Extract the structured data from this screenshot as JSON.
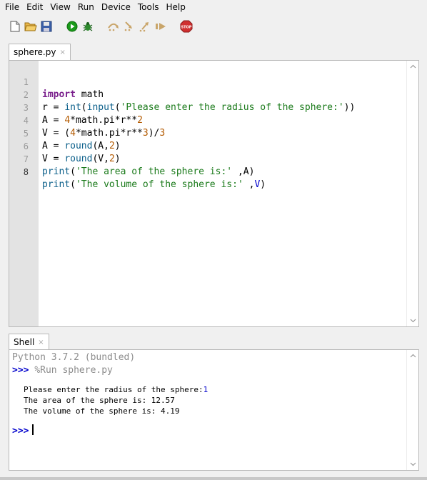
{
  "menu": {
    "items": [
      "File",
      "Edit",
      "View",
      "Run",
      "Device",
      "Tools",
      "Help"
    ]
  },
  "toolbar": {
    "buttons": [
      {
        "name": "new-file-button",
        "icon": "new-file-icon"
      },
      {
        "name": "open-file-button",
        "icon": "open-folder-icon"
      },
      {
        "name": "save-file-button",
        "icon": "save-icon"
      },
      {
        "name": "run-button",
        "icon": "run-icon"
      },
      {
        "name": "debug-button",
        "icon": "bug-icon"
      },
      {
        "name": "step-over-button",
        "icon": "step-over-icon"
      },
      {
        "name": "step-into-button",
        "icon": "step-into-icon"
      },
      {
        "name": "step-out-button",
        "icon": "step-out-icon"
      },
      {
        "name": "resume-button",
        "icon": "resume-icon"
      },
      {
        "name": "stop-button",
        "icon": "stop-icon",
        "label": "STOP"
      }
    ],
    "colors": {
      "run": "#1a9a1a",
      "stop": "#d03030"
    }
  },
  "editor": {
    "tab_title": "sphere.py",
    "tab_close": "×",
    "line_numbers": [
      "1",
      "2",
      "3",
      "4",
      "5",
      "6",
      "7",
      "8"
    ],
    "active_line": 8
  },
  "shell": {
    "tab_title": "Shell",
    "tab_close": "×",
    "banner": "Python 3.7.2 (bundled)",
    "prompt": ">>>",
    "command": "%Run sphere.py",
    "output_prompt": "Please enter the radius of the sphere:",
    "user_input": "1",
    "output_area": "The area of the sphere is: 12.57",
    "output_volume": "The volume of the sphere is: 4.19"
  }
}
